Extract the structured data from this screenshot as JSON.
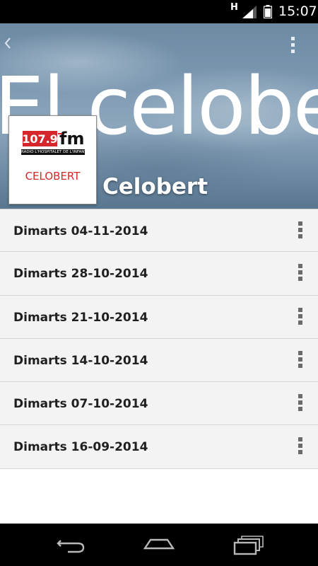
{
  "status_bar": {
    "network_indicator": "H",
    "time": "15:07",
    "icons": [
      "signal-icon",
      "battery-icon"
    ]
  },
  "header": {
    "background_text": "El celobert",
    "show_title": "Celobert",
    "back_icon": "back-chevron-icon",
    "overflow_icon": "overflow-menu-icon"
  },
  "logo": {
    "frequency": "107.9",
    "band": "fm",
    "station_caption": "RADIO L'HOSPITALET DE L'INFANT",
    "program_name": "CELOBERT",
    "colors": {
      "accent": "#d4262b",
      "dark": "#111111"
    }
  },
  "episodes": [
    {
      "label": "Dimarts 04-11-2014"
    },
    {
      "label": "Dimarts 28-10-2014"
    },
    {
      "label": "Dimarts 21-10-2014"
    },
    {
      "label": "Dimarts 14-10-2014"
    },
    {
      "label": "Dimarts 07-10-2014"
    },
    {
      "label": "Dimarts 16-09-2014"
    }
  ],
  "nav_bar": {
    "buttons": [
      "back-icon",
      "home-icon",
      "recents-icon"
    ]
  }
}
